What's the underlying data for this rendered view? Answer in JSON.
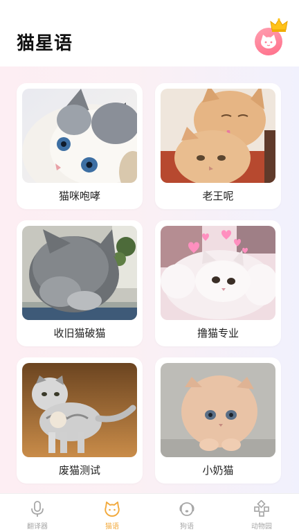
{
  "header": {
    "title": "猫星语"
  },
  "cards": [
    {
      "label": "猫咪咆哮",
      "image": "ragdoll-kitten-photo"
    },
    {
      "label": "老王呢",
      "image": "two-orange-cats-photo"
    },
    {
      "label": "收旧猫破猫",
      "image": "grey-cat-grooming-photo"
    },
    {
      "label": "撸猫专业",
      "image": "white-kitten-hearts-photo"
    },
    {
      "label": "废猫测试",
      "image": "scottish-fold-kitten-photo"
    },
    {
      "label": "小奶猫",
      "image": "cream-exotic-kitten-photo"
    }
  ],
  "tabbar": {
    "items": [
      {
        "label": "翻译器",
        "icon": "microphone-icon",
        "active": false
      },
      {
        "label": "猫语",
        "icon": "cat-face-icon",
        "active": true
      },
      {
        "label": "狗语",
        "icon": "dog-face-icon",
        "active": false
      },
      {
        "label": "动物园",
        "icon": "zoo-grid-icon",
        "active": false
      }
    ]
  },
  "colors": {
    "accent": "#f2a93b",
    "inactive": "#a7a7a7",
    "vip_avatar": "#ff7f96",
    "crown": "#ffc21a"
  }
}
